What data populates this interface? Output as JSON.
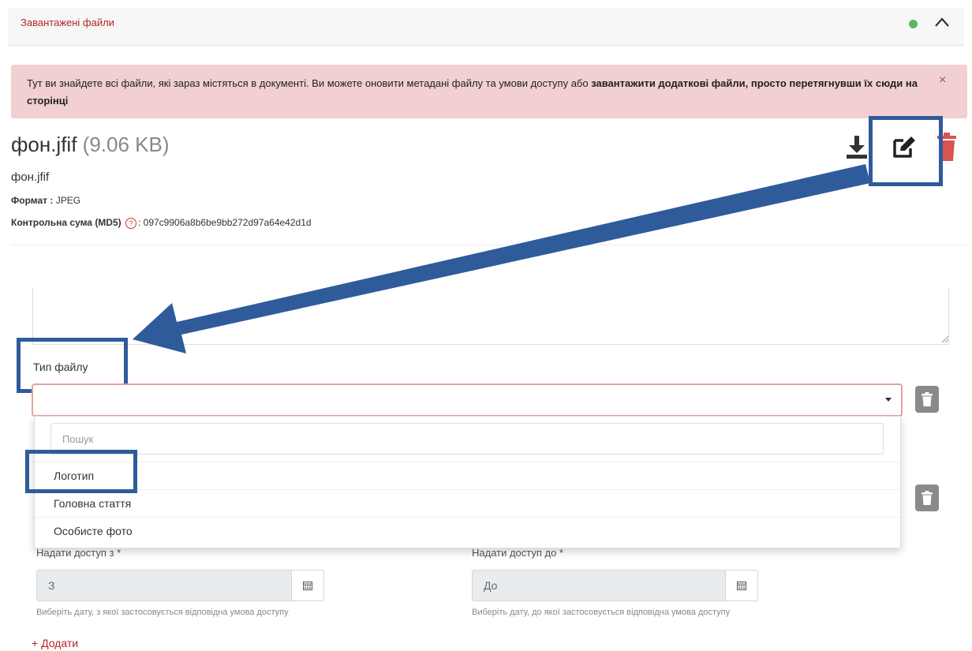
{
  "panel": {
    "title": "Завантажені файли"
  },
  "alert": {
    "text_plain": "Тут ви знайдете всі файли, які зараз містяться в документі. Ви можете оновити метадані файлу та умови доступу або ",
    "text_bold": "завантажити додаткові файли, просто перетягнувши їх сюди на сторінці",
    "close": "×"
  },
  "file": {
    "title": "фон.jfif",
    "size": "(9.06 KB)",
    "name": "фон.jfif",
    "format_label": "Формат :",
    "format_value": "JPEG",
    "md5_label": "Контрольна сума (MD5)",
    "md5_help": "?",
    "md5_value": ": 097c9906a8b6be9bb272d97a64e42d1d"
  },
  "file_type": {
    "label": "Тип файлу",
    "search_placeholder": "Пошук",
    "options": [
      "Логотип",
      "Головна стаття",
      "Особисте фото"
    ]
  },
  "access": {
    "from_label": "Надати доступ з *",
    "from_placeholder": "З",
    "from_help": "Виберіть дату, з якої застосовується відповідна умова доступу",
    "to_label": "Надати доступ до *",
    "to_placeholder": "До",
    "to_help": "Виберіть дату, до якої застосовується відповідна умова доступу"
  },
  "add_label": "+ Додати",
  "colors": {
    "accent_red": "#b52424",
    "highlight_blue": "#2f5b9b",
    "alert_bg": "#f2cfd0",
    "ok_green": "#5cb85c"
  },
  "icons": [
    "check-circle-icon",
    "chevron-up-icon",
    "close-icon",
    "download-icon",
    "edit-icon",
    "trash-icon",
    "calendar-icon",
    "help-icon",
    "caret-down-icon"
  ]
}
